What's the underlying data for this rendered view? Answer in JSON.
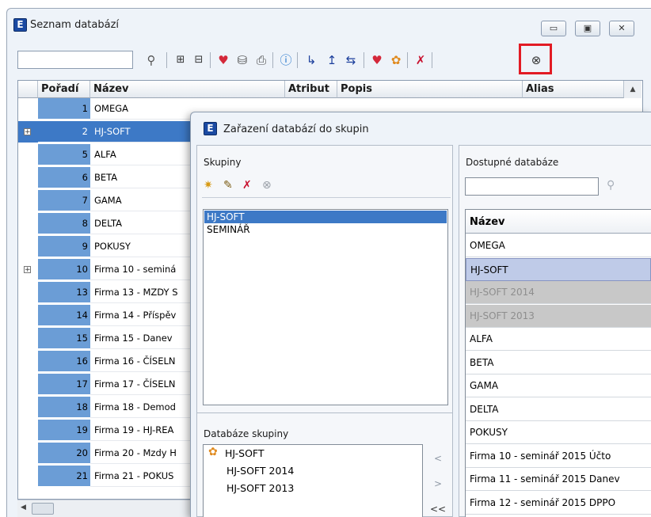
{
  "main_window": {
    "title": "Seznam databází",
    "controls": {
      "minimize": "▭",
      "maximize": "▣",
      "close": "✕"
    }
  },
  "toolbar": {
    "search_value": "",
    "icons": [
      "binoculars-icon",
      "expand-all-icon",
      "collapse-all-icon",
      "database-heart-icon",
      "database-group-icon",
      "database-print-icon",
      "info-icon",
      "import-icon",
      "export-icon",
      "transfer-icon",
      "heart-icon",
      "group-assign-icon",
      "delete-icon",
      "database-group-assign-icon"
    ]
  },
  "grid": {
    "columns": [
      "Pořadí",
      "Název",
      "Atribut",
      "Popis",
      "Alias"
    ],
    "rows": [
      {
        "order": "1",
        "name": "OMEGA",
        "expander": ""
      },
      {
        "order": "2",
        "name": "HJ-SOFT",
        "expander": "⊞",
        "selected": true
      },
      {
        "order": "5",
        "name": "ALFA",
        "expander": ""
      },
      {
        "order": "6",
        "name": "BETA",
        "expander": ""
      },
      {
        "order": "7",
        "name": "GAMA",
        "expander": ""
      },
      {
        "order": "8",
        "name": "DELTA",
        "expander": ""
      },
      {
        "order": "9",
        "name": "POKUSY",
        "expander": ""
      },
      {
        "order": "10",
        "name": "Firma 10 - seminá",
        "expander": "⊞"
      },
      {
        "order": "13",
        "name": "Firma 13 - MZDY S",
        "expander": ""
      },
      {
        "order": "14",
        "name": "Firma 14 - Příspěv",
        "expander": ""
      },
      {
        "order": "15",
        "name": "Firma 15 - Danev",
        "expander": ""
      },
      {
        "order": "16",
        "name": "Firma 16 - ČÍSELN",
        "expander": ""
      },
      {
        "order": "17",
        "name": "Firma 17 - ČÍSELN",
        "expander": ""
      },
      {
        "order": "18",
        "name": "Firma 18 - Demod",
        "expander": ""
      },
      {
        "order": "19",
        "name": "Firma 19 - HJ-REA",
        "expander": ""
      },
      {
        "order": "20",
        "name": "Firma 20 - Mzdy H",
        "expander": ""
      },
      {
        "order": "21",
        "name": "Firma 21 - POKUS",
        "expander": ""
      }
    ]
  },
  "dialog": {
    "title": "Zařazení databází do skupin",
    "groups_label": "Skupiny",
    "groups": [
      "HJ-SOFT",
      "SEMINÁŘ"
    ],
    "group_members_label": "Databáze skupiny",
    "group_members": [
      {
        "name": "HJ-SOFT",
        "icon": "group-icon"
      },
      {
        "name": "HJ-SOFT 2014",
        "icon": ""
      },
      {
        "name": "HJ-SOFT 2013",
        "icon": ""
      }
    ],
    "available_label": "Dostupné databáze",
    "available_search_value": "",
    "available_column": "Název",
    "available": [
      {
        "name": "OMEGA",
        "state": "normal"
      },
      {
        "name": "HJ-SOFT",
        "state": "highlighted"
      },
      {
        "name": "HJ-SOFT 2014",
        "state": "disabled"
      },
      {
        "name": "HJ-SOFT 2013",
        "state": "disabled"
      },
      {
        "name": "ALFA",
        "state": "normal"
      },
      {
        "name": "BETA",
        "state": "normal"
      },
      {
        "name": "GAMA",
        "state": "normal"
      },
      {
        "name": "DELTA",
        "state": "normal"
      },
      {
        "name": "POKUSY",
        "state": "normal"
      },
      {
        "name": "Firma 10 - seminář 2015 Účto",
        "state": "normal"
      },
      {
        "name": "Firma 11 - seminář 2015 Danev",
        "state": "normal"
      },
      {
        "name": "Firma 12 - seminář 2015 DPPO",
        "state": "normal"
      }
    ],
    "transfer_buttons": [
      "<",
      ">",
      "<<"
    ]
  },
  "colors": {
    "selection": "#3d79c6",
    "order_column": "#6b9dd6",
    "highlight_frame": "#e21b24",
    "disabled_row": "#c8c8c8"
  }
}
